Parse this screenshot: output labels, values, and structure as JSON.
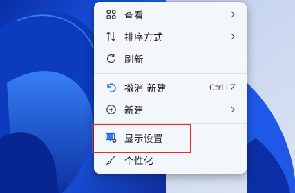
{
  "context_menu": {
    "items": [
      {
        "label": "查看",
        "icon": "view-grid-icon",
        "has_submenu": true
      },
      {
        "label": "排序方式",
        "icon": "sort-icon",
        "has_submenu": true
      },
      {
        "label": "刷新",
        "icon": "refresh-icon",
        "has_submenu": false
      },
      {
        "label": "撤消 新建",
        "icon": "undo-icon",
        "shortcut": "Ctrl+Z"
      },
      {
        "label": "新建",
        "icon": "new-plus-icon",
        "has_submenu": true
      },
      {
        "label": "显示设置",
        "icon": "display-settings-icon",
        "highlighted": true
      },
      {
        "label": "个性化",
        "icon": "personalize-brush-icon"
      }
    ]
  },
  "colors": {
    "menu_bg": "#f3f6fb",
    "highlight_border": "#e52d2d",
    "wallpaper_blue": "#1a4fd6",
    "wallpaper_right": "#c6d4ee"
  }
}
